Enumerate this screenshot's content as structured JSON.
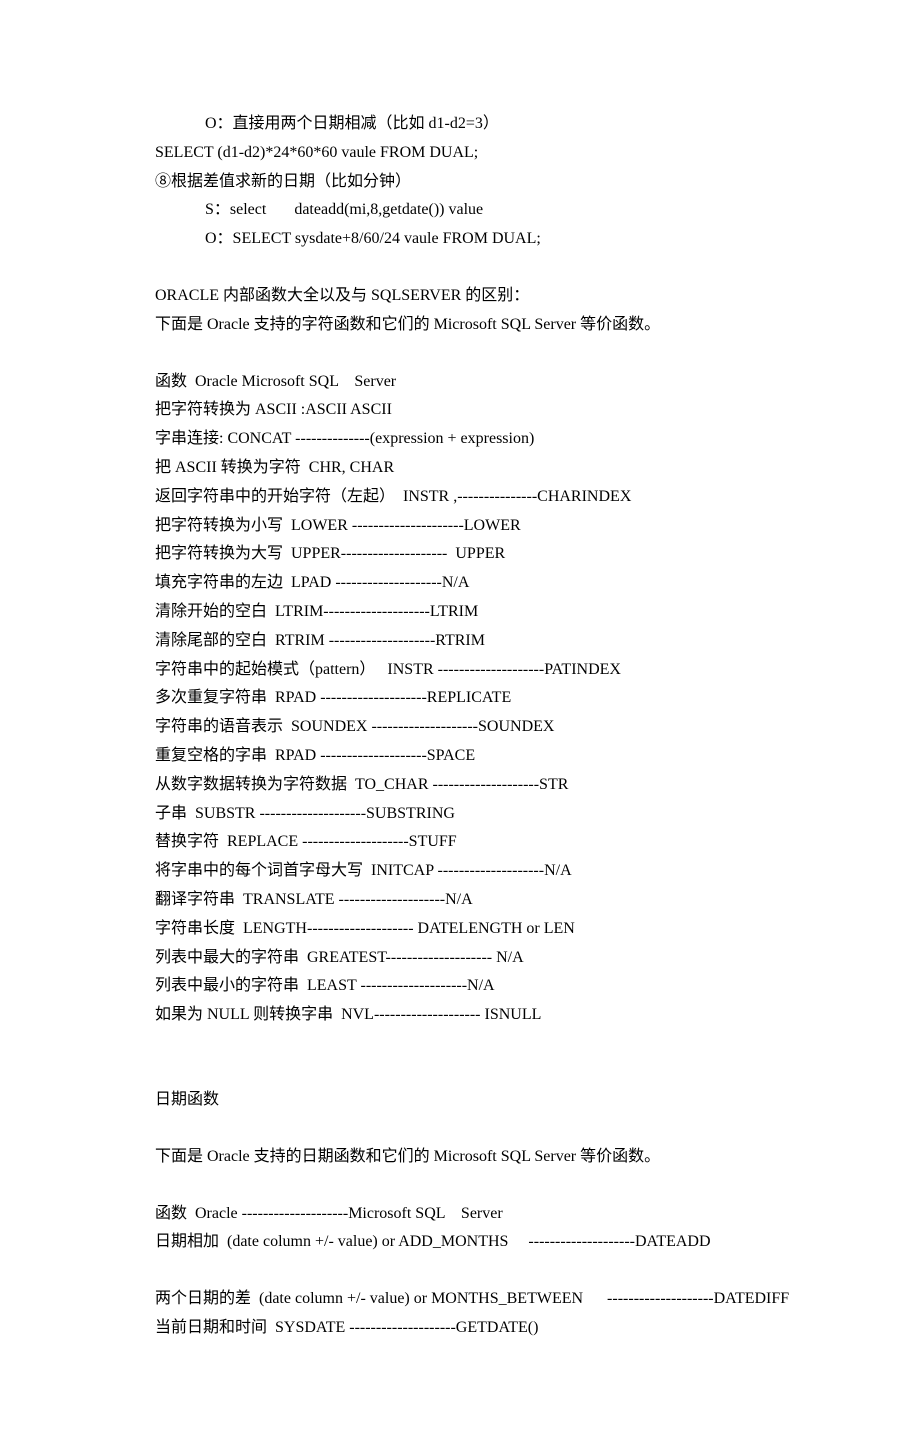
{
  "top_lines": [
    "O：直接用两个日期相减（比如 d1-d2=3）"
  ],
  "main_lines": [
    "SELECT (d1-d2)*24*60*60 vaule FROM DUAL;",
    "⑧根据差值求新的日期（比如分钟）"
  ],
  "indent_lines": [
    "S：select       dateadd(mi,8,getdate()) value",
    "O：SELECT sysdate+8/60/24 vaule FROM DUAL;"
  ],
  "section1": [
    "ORACLE 内部函数大全以及与 SQLSERVER 的区别：",
    "下面是 Oracle 支持的字符函数和它们的 Microsoft SQL Server 等价函数。"
  ],
  "section2": [
    "函数  Oracle Microsoft SQL    Server",
    "把字符转换为 ASCII :ASCII ASCII",
    "字串连接: CONCAT --------------(expression + expression)",
    "把 ASCII 转换为字符  CHR, CHAR",
    "返回字符串中的开始字符（左起）  INSTR ,---------------CHARINDEX",
    "把字符转换为小写  LOWER ---------------------LOWER",
    "把字符转换为大写  UPPER--------------------  UPPER",
    "填充字符串的左边  LPAD --------------------N/A",
    "清除开始的空白  LTRIM--------------------LTRIM",
    "清除尾部的空白  RTRIM --------------------RTRIM",
    "字符串中的起始模式（pattern）   INSTR --------------------PATINDEX",
    "多次重复字符串  RPAD --------------------REPLICATE",
    "字符串的语音表示  SOUNDEX --------------------SOUNDEX",
    "重复空格的字串  RPAD --------------------SPACE",
    "从数字数据转换为字符数据  TO_CHAR --------------------STR",
    "子串  SUBSTR --------------------SUBSTRING",
    "替换字符  REPLACE --------------------STUFF",
    "将字串中的每个词首字母大写  INITCAP --------------------N/A",
    "翻译字符串  TRANSLATE --------------------N/A",
    "字符串长度  LENGTH-------------------- DATELENGTH or LEN",
    "列表中最大的字符串  GREATEST-------------------- N/A",
    "列表中最小的字符串  LEAST --------------------N/A",
    "如果为 NULL 则转换字串  NVL-------------------- ISNULL"
  ],
  "section3_title": "日期函数",
  "section3_desc": "下面是 Oracle 支持的日期函数和它们的 Microsoft SQL Server 等价函数。",
  "section4": [
    "函数  Oracle --------------------Microsoft SQL    Server",
    "日期相加  (date column +/- value) or ADD_MONTHS     --------------------DATEADD"
  ],
  "section5": [
    "两个日期的差  (date column +/- value) or MONTHS_BETWEEN      --------------------DATEDIFF",
    "当前日期和时间  SYSDATE --------------------GETDATE()"
  ]
}
